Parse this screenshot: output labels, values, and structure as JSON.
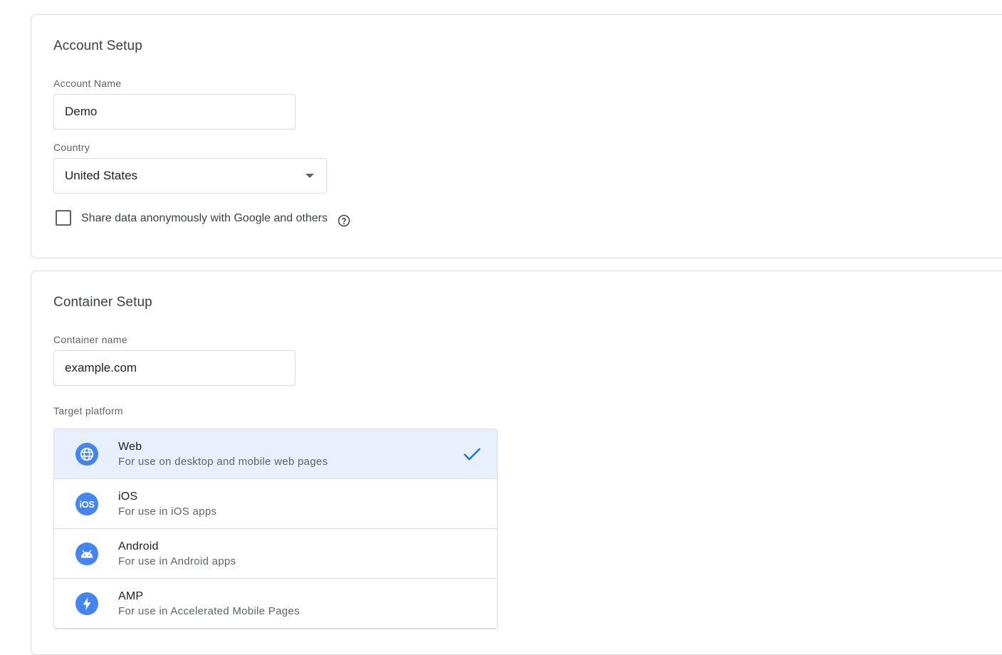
{
  "account_setup": {
    "title": "Account Setup",
    "account_name_label": "Account Name",
    "account_name_value": "Demo",
    "country_label": "Country",
    "country_value": "United States",
    "share_data_label": "Share data anonymously with Google and others",
    "share_data_checked": false
  },
  "container_setup": {
    "title": "Container Setup",
    "container_name_label": "Container name",
    "container_name_value": "example.com",
    "target_platform_label": "Target platform",
    "platforms": [
      {
        "name": "Web",
        "description": "For use on desktop and mobile web pages",
        "icon": "globe-icon",
        "selected": true
      },
      {
        "name": "iOS",
        "description": "For use in iOS apps",
        "icon": "ios-icon",
        "selected": false
      },
      {
        "name": "Android",
        "description": "For use in Android apps",
        "icon": "android-icon",
        "selected": false
      },
      {
        "name": "AMP",
        "description": "For use in Accelerated Mobile Pages",
        "icon": "lightning-icon",
        "selected": false
      }
    ]
  },
  "colors": {
    "accent": "#1a73e8",
    "icon_blue": "#4285f4",
    "selected_bg": "#e8f0fe",
    "border": "#dadce0"
  }
}
